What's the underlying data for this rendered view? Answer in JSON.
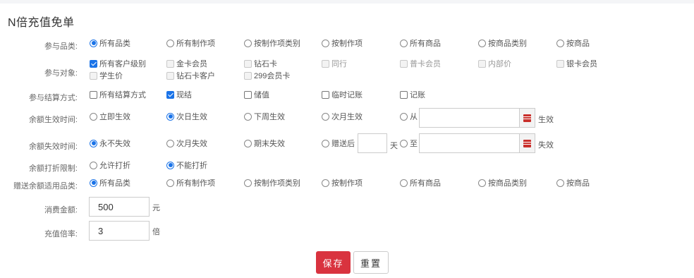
{
  "page_title": "N倍充值免单",
  "rows": {
    "category": {
      "label": "参与品类:",
      "options": [
        "所有品类",
        "所有制作项",
        "按制作项类别",
        "按制作项",
        "所有商品",
        "按商品类别",
        "按商品"
      ],
      "selected": 0
    },
    "target": {
      "label": "参与对象:",
      "options": [
        "所有客户级别",
        "金卡会员",
        "钻石卡",
        "同行",
        "普卡会员",
        "内部价",
        "银卡会员",
        "学生价",
        "钻石卡客户",
        "299会员卡"
      ],
      "checked": [
        0
      ]
    },
    "settlement": {
      "label": "参与结算方式:",
      "options": [
        "所有结算方式",
        "现结",
        "储值",
        "临时记账",
        "记账"
      ],
      "checked": [
        1
      ]
    },
    "effective": {
      "label": "余额生效时间:",
      "options": [
        "立即生效",
        "次日生效",
        "下周生效",
        "次月生效",
        "从"
      ],
      "selected": 1,
      "date_value": "",
      "suffix": "生效"
    },
    "expiry": {
      "label": "余额失效时间:",
      "options": [
        "永不失效",
        "次月失效",
        "期末失效",
        "赠送后",
        "至"
      ],
      "selected": 0,
      "days_value": "",
      "days_unit": "天",
      "date_value": "",
      "suffix": "失效"
    },
    "discount": {
      "label": "余额打折限制:",
      "options": [
        "允许打折",
        "不能打折"
      ],
      "selected": 1
    },
    "gift_category": {
      "label": "赠送余额适用品类:",
      "options": [
        "所有品类",
        "所有制作项",
        "按制作项类别",
        "按制作项",
        "所有商品",
        "按商品类别",
        "按商品"
      ],
      "selected": 0
    },
    "amount": {
      "label": "消费金额:",
      "value": "500",
      "unit": "元"
    },
    "multiplier": {
      "label": "充值倍率:",
      "value": "3",
      "unit": "倍"
    }
  },
  "buttons": {
    "save": "保存",
    "reset": "重置"
  },
  "colors": {
    "accent": "#1a73e8",
    "save_button": "#d9333f",
    "calendar_icon": "#c9302c"
  }
}
